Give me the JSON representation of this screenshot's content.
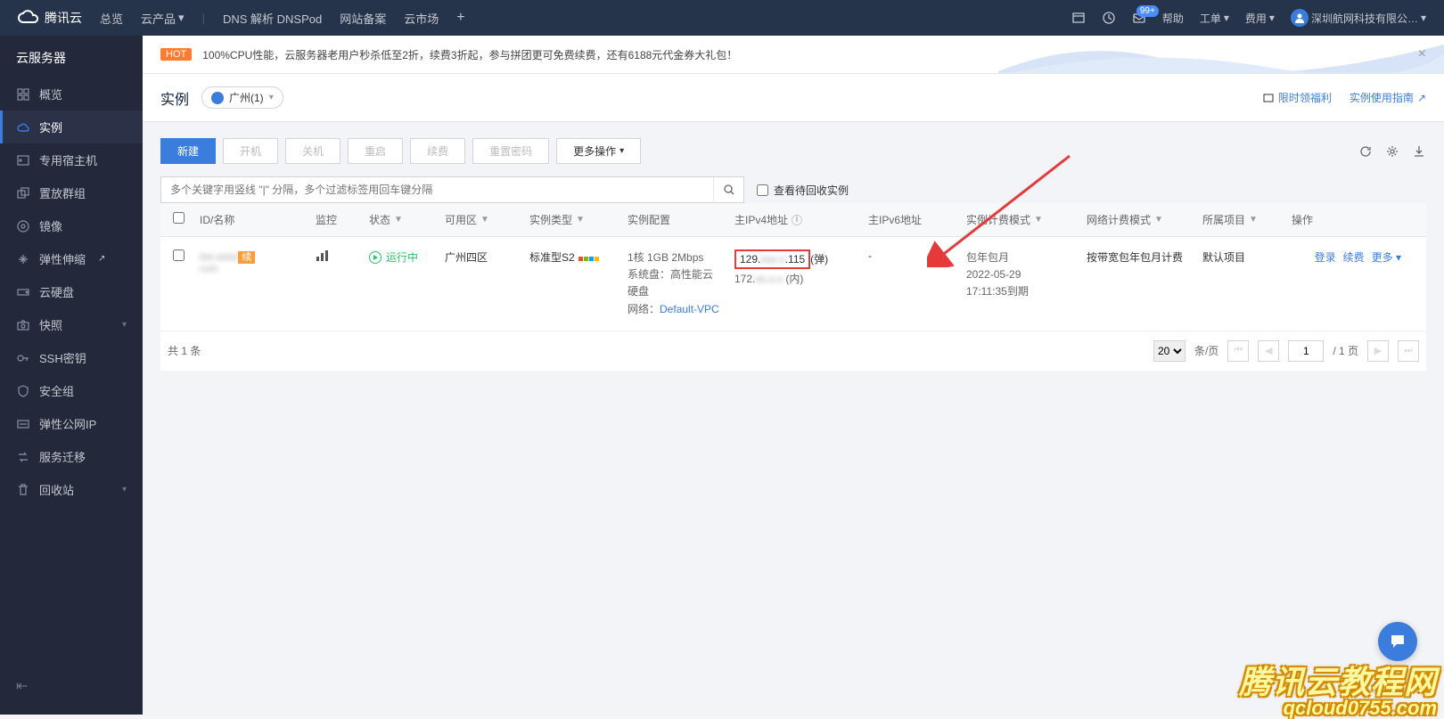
{
  "header": {
    "brand": "腾讯云",
    "nav": {
      "overview": "总览",
      "products": "云产品",
      "dnspod": "DNS 解析 DNSPod",
      "beian": "网站备案",
      "market": "云市场"
    },
    "right": {
      "badge": "99+",
      "help": "帮助",
      "workorder": "工单",
      "fee": "费用",
      "account": "深圳航网科技有限公…"
    }
  },
  "sidebar": {
    "title": "云服务器",
    "items": {
      "overview": "概览",
      "instance": "实例",
      "dedicated": "专用宿主机",
      "placement": "置放群组",
      "image": "镜像",
      "autoscale": "弹性伸缩",
      "disk": "云硬盘",
      "snapshot": "快照",
      "ssh": "SSH密钥",
      "sg": "安全组",
      "eip": "弹性公网IP",
      "migrate": "服务迁移",
      "recycle": "回收站"
    }
  },
  "banner": {
    "hot": "HOT",
    "text": "100%CPU性能，云服务器老用户秒杀低至2折，续费3折起，参与拼团更可免费续费，还有6188元代金券大礼包！"
  },
  "page": {
    "title": "实例",
    "region": "广州(1)",
    "promo": "限时领福利",
    "guide": "实例使用指南"
  },
  "actions": {
    "create": "新建",
    "start": "开机",
    "stop": "关机",
    "restart": "重启",
    "renew": "续费",
    "resetpw": "重置密码",
    "more": "更多操作"
  },
  "search": {
    "placeholder": "多个关键字用竖线 \"|\" 分隔，多个过滤标签用回车键分隔",
    "recycle_checkbox": "查看待回收实例"
  },
  "table": {
    "headers": {
      "id": "ID/名称",
      "monitor": "监控",
      "status": "状态",
      "zone": "可用区",
      "type": "实例类型",
      "config": "实例配置",
      "ipv4": "主IPv4地址",
      "ipv6": "主IPv6地址",
      "billing": "实例计费模式",
      "netbill": "网络计费模式",
      "project": "所属项目",
      "ops": "操作"
    },
    "row": {
      "id_blur": "ins-xxxx",
      "name_blur": "cvm",
      "renew_tag": "续",
      "status": "运行中",
      "zone": "广州四区",
      "type": "标准型S2",
      "config_spec": "1核 1GB 2Mbps",
      "config_disk_lbl": "系统盘：",
      "config_disk": "高性能云硬盘",
      "config_net_lbl": "网络：",
      "config_net": "Default-VPC",
      "ip_public_a": "129.",
      "ip_public_b": ".115",
      "ip_public_suffix": "(弹)",
      "ip_private_a": "172.",
      "ip_private_suffix": "(内)",
      "ipv6": "-",
      "billing_mode": "包年包月",
      "billing_expire": "2022-05-29",
      "billing_time": "17:11:35到期",
      "netbill": "按带宽包年包月计费",
      "project": "默认项目",
      "ops_login": "登录",
      "ops_renew": "续费",
      "ops_more": "更多"
    },
    "footer": {
      "total": "共 1 条",
      "page_size": "20",
      "per_page": "条/页",
      "page_current": "1",
      "page_total": "/ 1 页"
    }
  },
  "watermark": {
    "line1": "腾讯云教程网",
    "line2": "qcloud0755.com"
  }
}
